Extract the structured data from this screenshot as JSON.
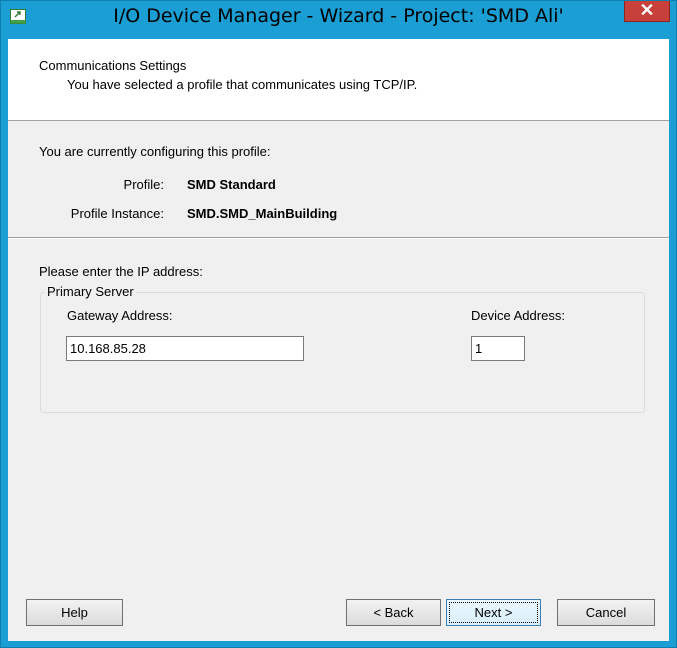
{
  "window": {
    "title": "I/O Device Manager - Wizard - Project: 'SMD Ali'",
    "frame_color": "#1a9ed4",
    "close_color": "#c7403a"
  },
  "header": {
    "title": "Communications Settings",
    "description": "You have selected a profile that communicates using TCP/IP."
  },
  "profile_section": {
    "intro": "You are currently configuring this profile:",
    "profile_label": "Profile:",
    "profile_value": "SMD Standard",
    "instance_label": "Profile Instance:",
    "instance_value": "SMD.SMD_MainBuilding"
  },
  "ip_section": {
    "prompt": "Please enter the IP address:",
    "group_title": "Primary Server",
    "gateway_label": "Gateway Address:",
    "gateway_value": "10.168.85.28",
    "device_label": "Device Address:",
    "device_value": "1"
  },
  "buttons": {
    "help": "Help",
    "back": "< Back",
    "next": "Next >",
    "cancel": "Cancel"
  }
}
